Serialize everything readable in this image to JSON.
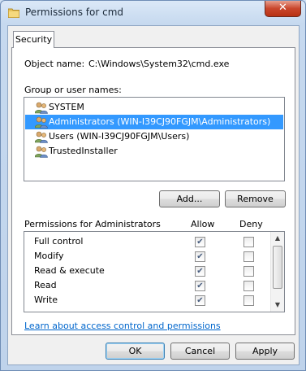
{
  "window": {
    "title": "Permissions for cmd",
    "close_label": "✕"
  },
  "tabs": [
    {
      "label": "Security"
    }
  ],
  "object": {
    "label": "Object name:",
    "value": "C:\\Windows\\System32\\cmd.exe"
  },
  "group": {
    "label": "Group or user names:",
    "items": [
      {
        "label": "SYSTEM",
        "selected": false
      },
      {
        "label": "Administrators (WIN-I39CJ90FGJM\\Administrators)",
        "selected": true
      },
      {
        "label": "Users (WIN-I39CJ90FGJM\\Users)",
        "selected": false
      },
      {
        "label": "TrustedInstaller",
        "selected": false
      }
    ],
    "icon": "user-group-icon"
  },
  "buttons": {
    "add": "Add...",
    "remove": "Remove",
    "ok": "OK",
    "cancel": "Cancel",
    "apply": "Apply"
  },
  "permissions": {
    "label": "Permissions for Administrators",
    "allow_header": "Allow",
    "deny_header": "Deny",
    "rows": [
      {
        "name": "Full control",
        "allow": true,
        "deny": false
      },
      {
        "name": "Modify",
        "allow": true,
        "deny": false
      },
      {
        "name": "Read & execute",
        "allow": true,
        "deny": false
      },
      {
        "name": "Read",
        "allow": true,
        "deny": false
      },
      {
        "name": "Write",
        "allow": true,
        "deny": false
      }
    ]
  },
  "link": {
    "text": "Learn about access control and permissions"
  },
  "colors": {
    "selection": "#3399ff",
    "link": "#0066cc",
    "close": "#c9462c"
  }
}
